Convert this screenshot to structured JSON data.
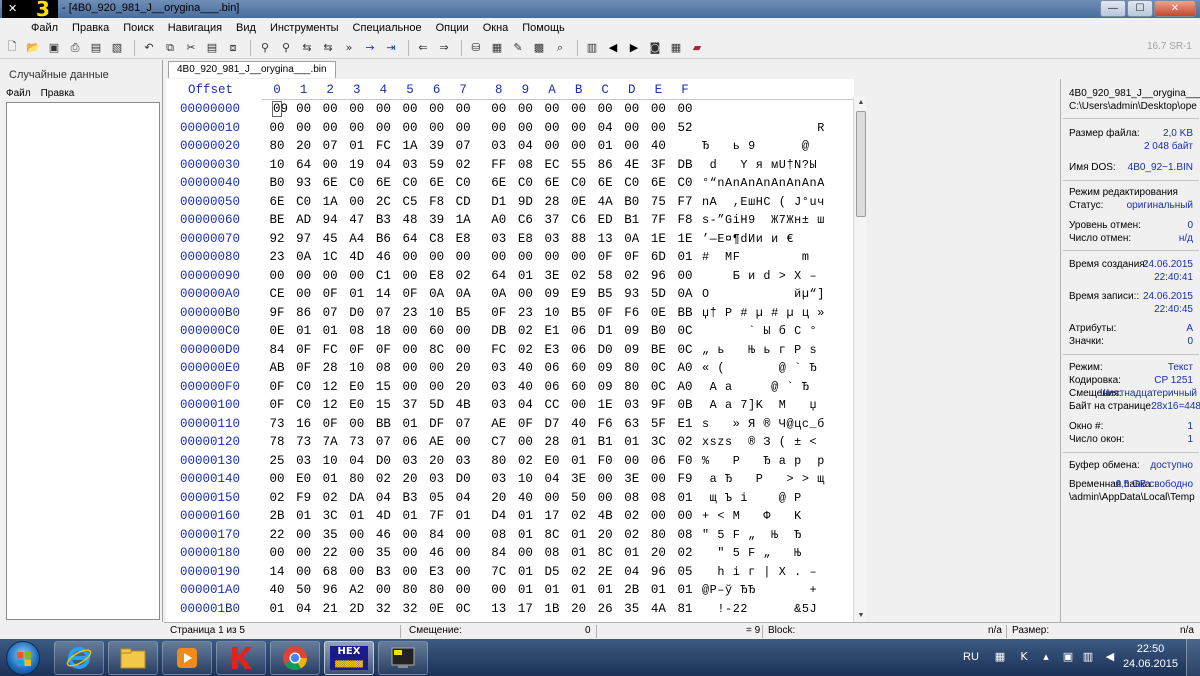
{
  "window": {
    "title": "- [4B0_920_981_J__orygina___.bin]",
    "version_text": "16.7 SR-1",
    "buttons": {
      "minimize": "—",
      "maximize": "☐",
      "close": "✕"
    }
  },
  "menu": [
    "Файл",
    "Правка",
    "Поиск",
    "Навигация",
    "Вид",
    "Инструменты",
    "Специальное",
    "Опции",
    "Окна",
    "Помощь"
  ],
  "toolbar_icons": [
    "new-file-icon",
    "open-folder-icon",
    "save-icon",
    "print-icon",
    "properties-icon",
    "save-all-icon",
    "undo-icon",
    "copy-icon",
    "cut-icon",
    "paste-icon",
    "paste-special-icon",
    "find-icon",
    "find-hex-icon",
    "replace-icon",
    "replace-hex-icon",
    "find-next-icon",
    "goto-offset-icon",
    "goto-sector-icon",
    "back-icon",
    "forward-icon",
    "disk-edit-icon",
    "ram-edit-icon",
    "tools-icon",
    "calculator-icon",
    "search-icon",
    "select-icon",
    "prev-icon",
    "next-icon",
    "camera-icon",
    "table-icon",
    "book-icon"
  ],
  "left_panel": {
    "title": "Случайные данные",
    "menu": [
      "Файл",
      "Правка"
    ]
  },
  "tab": {
    "label": "4B0_920_981_J__orygina___.bin"
  },
  "hex": {
    "offset_header": "Offset",
    "columns": [
      "0",
      "1",
      "2",
      "3",
      "4",
      "5",
      "6",
      "7",
      "8",
      "9",
      "A",
      "B",
      "C",
      "D",
      "E",
      "F"
    ],
    "rows": [
      {
        "offset": "00000000",
        "bytes": [
          "09",
          "00",
          "00",
          "00",
          "00",
          "00",
          "00",
          "00",
          "00",
          "00",
          "00",
          "00",
          "00",
          "00",
          "00",
          "00"
        ],
        "text": ""
      },
      {
        "offset": "00000010",
        "bytes": [
          "00",
          "00",
          "00",
          "00",
          "00",
          "00",
          "00",
          "00",
          "00",
          "00",
          "00",
          "00",
          "04",
          "00",
          "00",
          "52"
        ],
        "text": "               R"
      },
      {
        "offset": "00000020",
        "bytes": [
          "80",
          "20",
          "07",
          "01",
          "FC",
          "1A",
          "39",
          "07",
          "03",
          "04",
          "00",
          "00",
          "01",
          "00",
          "40"
        ],
        "text": "Ђ   ь 9      @"
      },
      {
        "offset": "00000030",
        "bytes": [
          "10",
          "64",
          "00",
          "19",
          "04",
          "03",
          "59",
          "02",
          "FF",
          "08",
          "EC",
          "55",
          "86",
          "4E",
          "3F",
          "DB"
        ],
        "text": " d   Y я мU†N?Ы"
      },
      {
        "offset": "00000040",
        "bytes": [
          "B0",
          "93",
          "6E",
          "C0",
          "6E",
          "C0",
          "6E",
          "C0",
          "6E",
          "C0",
          "6E",
          "C0",
          "6E",
          "C0",
          "6E",
          "C0"
        ],
        "text": "°“nAnAnAnAnAnAnA"
      },
      {
        "offset": "00000050",
        "bytes": [
          "6E",
          "C0",
          "1A",
          "00",
          "2C",
          "C5",
          "F8",
          "CD",
          "D1",
          "9D",
          "28",
          "0E",
          "4A",
          "B0",
          "75",
          "F7"
        ],
        "text": "nA  ,ЕшНС ( J°uч"
      },
      {
        "offset": "00000060",
        "bytes": [
          "BE",
          "AD",
          "94",
          "47",
          "B3",
          "48",
          "39",
          "1A",
          "A0",
          "C6",
          "37",
          "C6",
          "ED",
          "B1",
          "7F",
          "F8"
        ],
        "text": "s-”GiH9  Ж7Жн± ш"
      },
      {
        "offset": "00000070",
        "bytes": [
          "92",
          "97",
          "45",
          "A4",
          "B6",
          "64",
          "C8",
          "E8",
          "03",
          "E8",
          "03",
          "88",
          "13",
          "0A",
          "1E",
          "1E"
        ],
        "text": "’—E¤¶dИи и €"
      },
      {
        "offset": "00000080",
        "bytes": [
          "23",
          "0A",
          "1C",
          "4D",
          "46",
          "00",
          "00",
          "00",
          "00",
          "00",
          "00",
          "00",
          "0F",
          "0F",
          "6D",
          "01"
        ],
        "text": "#  MF        m"
      },
      {
        "offset": "00000090",
        "bytes": [
          "00",
          "00",
          "00",
          "00",
          "C1",
          "00",
          "E8",
          "02",
          "64",
          "01",
          "3E",
          "02",
          "58",
          "02",
          "96",
          "00"
        ],
        "text": "    Б и d > X –"
      },
      {
        "offset": "000000A0",
        "bytes": [
          "CE",
          "00",
          "0F",
          "01",
          "14",
          "0F",
          "0A",
          "0A",
          "0A",
          "00",
          "09",
          "E9",
          "B5",
          "93",
          "5D",
          "0A"
        ],
        "text": "О           йµ“]"
      },
      {
        "offset": "000000B0",
        "bytes": [
          "9F",
          "86",
          "07",
          "D0",
          "07",
          "23",
          "10",
          "B5",
          "0F",
          "23",
          "10",
          "B5",
          "0F",
          "F6",
          "0E",
          "BB"
        ],
        "text": "џ† Р # µ # µ ц »"
      },
      {
        "offset": "000000C0",
        "bytes": [
          "0E",
          "01",
          "01",
          "08",
          "18",
          "00",
          "60",
          "00",
          "DB",
          "02",
          "E1",
          "06",
          "D1",
          "09",
          "B0",
          "0C"
        ],
        "text": "      ` Ы б С °"
      },
      {
        "offset": "000000D0",
        "bytes": [
          "84",
          "0F",
          "FC",
          "0F",
          "0F",
          "00",
          "8C",
          "00",
          "FC",
          "02",
          "E3",
          "06",
          "D0",
          "09",
          "BE",
          "0C"
        ],
        "text": "„ ь   Њ ь г Р s"
      },
      {
        "offset": "000000E0",
        "bytes": [
          "AB",
          "0F",
          "28",
          "10",
          "08",
          "00",
          "00",
          "20",
          "03",
          "40",
          "06",
          "60",
          "09",
          "80",
          "0C",
          "A0"
        ],
        "text": "« (       @ ` Ђ"
      },
      {
        "offset": "000000F0",
        "bytes": [
          "0F",
          "C0",
          "12",
          "E0",
          "15",
          "00",
          "00",
          "20",
          "03",
          "40",
          "06",
          "60",
          "09",
          "80",
          "0C",
          "A0"
        ],
        "text": " А а     @ ` Ђ"
      },
      {
        "offset": "00000100",
        "bytes": [
          "0F",
          "C0",
          "12",
          "E0",
          "15",
          "37",
          "5D",
          "4B",
          "03",
          "04",
          "CC",
          "00",
          "1E",
          "03",
          "9F",
          "0B"
        ],
        "text": " А а 7]K  М   џ"
      },
      {
        "offset": "00000110",
        "bytes": [
          "73",
          "16",
          "0F",
          "00",
          "BB",
          "01",
          "DF",
          "07",
          "AE",
          "0F",
          "D7",
          "40",
          "F6",
          "63",
          "5F",
          "E1"
        ],
        "text": "s   » Я ® Ч@цс_б"
      },
      {
        "offset": "00000120",
        "bytes": [
          "78",
          "73",
          "7A",
          "73",
          "07",
          "06",
          "AE",
          "00",
          "C7",
          "00",
          "28",
          "01",
          "B1",
          "01",
          "3C",
          "02"
        ],
        "text": "xszs  ® З ( ± <"
      },
      {
        "offset": "00000130",
        "bytes": [
          "25",
          "03",
          "10",
          "04",
          "D0",
          "03",
          "20",
          "03",
          "80",
          "02",
          "E0",
          "01",
          "F0",
          "00",
          "06",
          "F0"
        ],
        "text": "%   Р   Ђ а р  р"
      },
      {
        "offset": "00000140",
        "bytes": [
          "00",
          "E0",
          "01",
          "80",
          "02",
          "20",
          "03",
          "D0",
          "03",
          "10",
          "04",
          "3E",
          "00",
          "3E",
          "00",
          "F9"
        ],
        "text": " а Ђ   Р   > > щ"
      },
      {
        "offset": "00000150",
        "bytes": [
          "02",
          "F9",
          "02",
          "DA",
          "04",
          "B3",
          "05",
          "04",
          "20",
          "40",
          "00",
          "50",
          "00",
          "08",
          "08",
          "01"
        ],
        "text": " щ Ъ і    @ P"
      },
      {
        "offset": "00000160",
        "bytes": [
          "2B",
          "01",
          "3C",
          "01",
          "4D",
          "01",
          "7F",
          "01",
          "D4",
          "01",
          "17",
          "02",
          "4B",
          "02",
          "00",
          "00"
        ],
        "text": "+ < M   Ф   K"
      },
      {
        "offset": "00000170",
        "bytes": [
          "22",
          "00",
          "35",
          "00",
          "46",
          "00",
          "84",
          "00",
          "08",
          "01",
          "8C",
          "01",
          "20",
          "02",
          "80",
          "08"
        ],
        "text": "\" 5 F „  Њ  Ђ"
      },
      {
        "offset": "00000180",
        "bytes": [
          "00",
          "00",
          "22",
          "00",
          "35",
          "00",
          "46",
          "00",
          "84",
          "00",
          "08",
          "01",
          "8C",
          "01",
          "20",
          "02"
        ],
        "text": "  \" 5 F „   Њ"
      },
      {
        "offset": "00000190",
        "bytes": [
          "14",
          "00",
          "68",
          "00",
          "B3",
          "00",
          "E3",
          "00",
          "7C",
          "01",
          "D5",
          "02",
          "2E",
          "04",
          "96",
          "05"
        ],
        "text": "  h і г | Х . –"
      },
      {
        "offset": "000001A0",
        "bytes": [
          "40",
          "50",
          "96",
          "A2",
          "00",
          "80",
          "80",
          "00",
          "00",
          "01",
          "01",
          "01",
          "01",
          "2B",
          "01",
          "01"
        ],
        "text": "@P–ў ЂЂ       +"
      },
      {
        "offset": "000001B0",
        "bytes": [
          "01",
          "04",
          "21",
          "2D",
          "32",
          "32",
          "0E",
          "0C",
          "13",
          "17",
          "1B",
          "20",
          "26",
          "35",
          "4A",
          "81"
        ],
        "text": "  !-22      &5J"
      }
    ]
  },
  "info": {
    "file_name": "4B0_920_981_J__orygina___.bin",
    "path": "C:\\Users\\admin\\Desktop\\ope",
    "size_label": "Размер файла:",
    "size_kb": "2,0 KB",
    "size_bytes": "2 048 байт",
    "dos_label": "Имя DOS:",
    "dos_name": "4B0_92~1.BIN",
    "edit_mode_label": "Режим редактирования",
    "status_label": "Статус:",
    "status": "оригинальный",
    "undo_level_label": "Уровень отмен:",
    "undo_level": "0",
    "undo_count_label": "Число отмен:",
    "undo_count": "н/д",
    "created_label": "Время создания:",
    "created_date": "24.06.2015",
    "created_time": "22:40:41",
    "written_label": "Время записи::",
    "written_date": "24.06.2015",
    "written_time": "22:40:45",
    "attributes_label": "Атрибуты:",
    "attributes": "A",
    "icons_label": "Значки:",
    "icons": "0",
    "mode_label": "Режим:",
    "mode": "Текст",
    "encoding_label": "Кодировка:",
    "encoding": "CP 1251",
    "offsets_label": "Смещения:",
    "offsets": "Шестнадцатеричный",
    "bytes_per_page_label": "Байт на странице:",
    "bytes_per_page": "28x16=448",
    "window_label": "Окно #:",
    "window": "1",
    "windows_count_label": "Число окон:",
    "windows_count": "1",
    "clipboard_label": "Буфер обмена:",
    "clipboard": "доступно",
    "temp_label": "Временная папка",
    "temp_free": "6,5 GB свободно",
    "temp_path": "\\admin\\AppData\\Local\\Temp"
  },
  "status": {
    "page": "Страница 1 из 5",
    "offset_label": "Смещение:",
    "offset_value": "0",
    "value": "= 9",
    "block_label": "Block:",
    "block_value": "n/a",
    "size_label": "Размер:",
    "size_value": "n/a"
  },
  "taskbar": {
    "apps": [
      "start-orb",
      "ie-icon",
      "explorer-icon",
      "media-player-icon",
      "kaspersky-icon",
      "chrome-icon",
      "winhex-icon",
      "terminal-icon"
    ],
    "hex_app_label": "HEX",
    "tray": {
      "lang": "RU",
      "time": "22:50",
      "date": "24.06.2015"
    }
  }
}
